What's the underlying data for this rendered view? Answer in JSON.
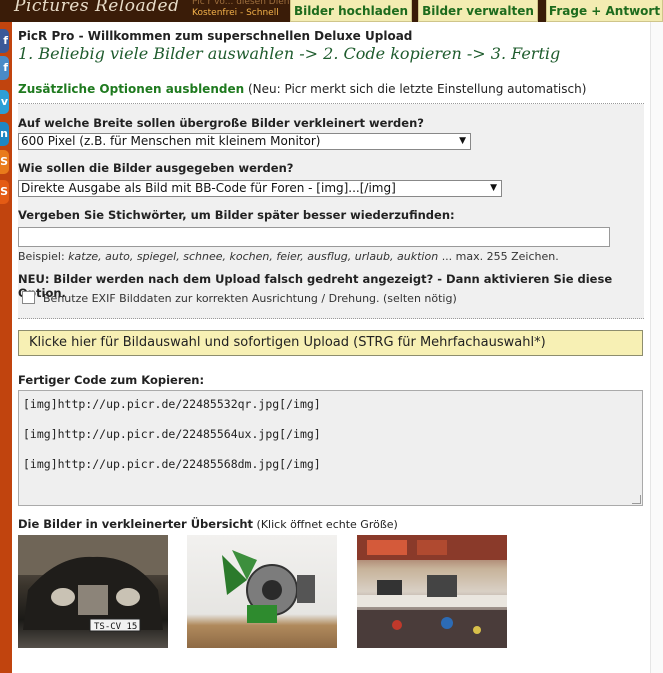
{
  "header": {
    "logo": "Pictures Reloaded",
    "tagline_line1": "Pic r vo... diesen Dien",
    "tagline_line2": "Kostenfrei - Schnell",
    "tabs": [
      {
        "label": "Bilder hochladen"
      },
      {
        "label": "Bilder verwalten"
      },
      {
        "label": "Frage + Antwort"
      }
    ]
  },
  "social": [
    "f",
    "f",
    "v",
    "in",
    "S",
    "S"
  ],
  "main": {
    "heading": "PicR Pro - Willkommen zum superschnellen Deluxe Upload",
    "steps": "1. Beliebig viele Bilder auswahlen -> 2. Code kopieren -> 3. Fertig",
    "options_link": "Zusätzliche Optionen ausblenden",
    "options_note": "(Neu: Picr merkt sich die letzte Einstellung automatisch)"
  },
  "options": {
    "width_label": "Auf welche Breite sollen übergroße Bilder verkleinert werden?",
    "width_value": "600 Pixel (z.B. für Menschen mit kleinem Monitor)",
    "output_label": "Wie sollen die Bilder ausgegeben werden?",
    "output_value": "Direkte Ausgabe als Bild mit BB-Code für Foren - [img]...[/img]",
    "keywords_label": "Vergeben Sie Stichwörter, um Bilder später besser wiederzufinden:",
    "keywords_value": "",
    "example_prefix": "Beispiel:",
    "example_words": "katze, auto, spiegel, schnee, kochen, feier, ausflug, urlaub, auktion",
    "example_suffix": "... max. 255 Zeichen.",
    "exif_label": "NEU: Bilder werden nach dem Upload falsch gedreht angezeigt? - Dann aktivieren Sie diese Option.",
    "exif_checkbox": "Benutze EXIF Bilddaten zur korrekten Ausrichtung / Drehung. (selten nötig)"
  },
  "upload_button": "Klicke hier für Bildauswahl und sofortigen Upload (STRG für Mehrfachauswahl*)",
  "code": {
    "label": "Fertiger Code zum Kopieren:",
    "lines": [
      "[img]http://up.picr.de/22485532qr.jpg[/img]",
      "[img]http://up.picr.de/22485564ux.jpg[/img]",
      "[img]http://up.picr.de/22485568dm.jpg[/img]"
    ]
  },
  "thumbnails": {
    "label": "Die Bilder in verkleinerter Übersicht",
    "note": "(Klick öffnet echte Größe)",
    "plate_text": "TS-CV 15"
  }
}
